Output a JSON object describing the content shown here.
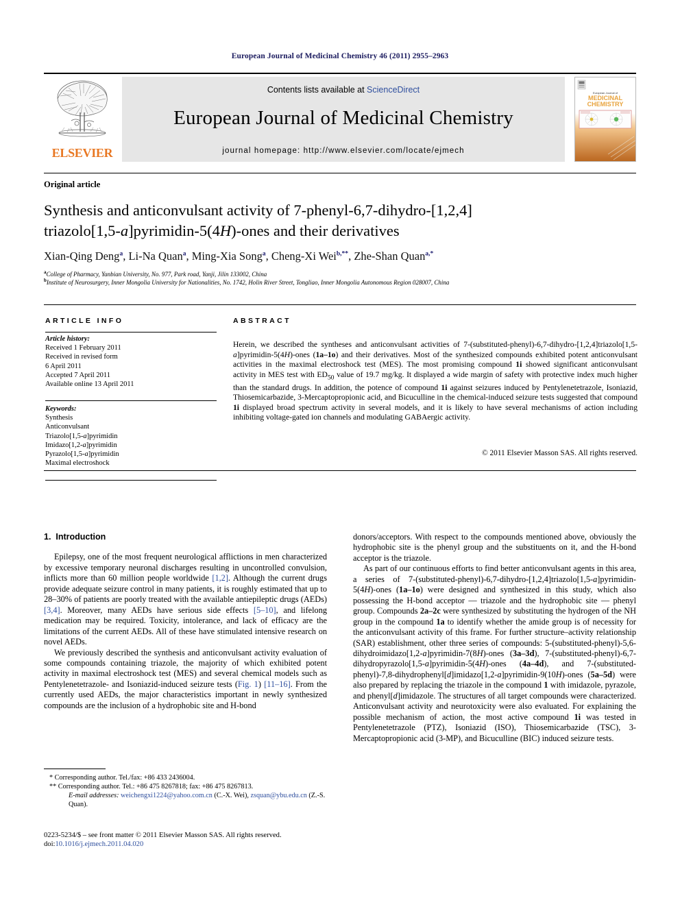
{
  "running_head": "European Journal of Medicinal Chemistry 46 (2011) 2955–2963",
  "masthead": {
    "contents_prefix": "Contents lists available at ",
    "sciencedirect": "ScienceDirect",
    "journal_title": "European Journal of Medicinal Chemistry",
    "homepage": "journal homepage: http://www.elsevier.com/locate/ejmech",
    "publisher": "ELSEVIER",
    "cover_title_small": "European Journal of",
    "cover_title_main1": "MEDICINAL",
    "cover_title_main2": "CHEMISTRY"
  },
  "article": {
    "type": "Original article",
    "title_line1": "Synthesis and anticonvulsant activity of 7-phenyl-6,7-dihydro-[1,2,4]",
    "title_line2_a": "triazolo[1,5-",
    "title_line2_b": "a",
    "title_line2_c": "]pyrimidin-5(4",
    "title_line2_d": "H",
    "title_line2_e": ")-ones and their derivatives",
    "authors": "Xian-Qing Deng a, Li-Na Quan a, Ming-Xia Song a, Cheng-Xi Wei b,**, Zhe-Shan Quan a,*",
    "affiliation_a": "College of Pharmacy, Yanbian University, No. 977, Park road, Yanji, Jilin 133002, China",
    "affiliation_b": "Institute of Neurosurgery, Inner Mongolia University for Nationalities, No. 1742, Holin River Street, Tongliao, Inner Mongolia Autonomous Region 028007, China"
  },
  "info": {
    "heading": "ARTICLE INFO",
    "history_label": "Article history:",
    "history": [
      "Received 1 February 2011",
      "Received in revised form",
      "6 April 2011",
      "Accepted 7 April 2011",
      "Available online 13 April 2011"
    ],
    "keywords_label": "Keywords:",
    "keywords": [
      "Synthesis",
      "Anticonvulsant",
      "Triazolo[1,5-a]pyrimidin",
      "Imidazo[1,2-a]pyrimidin",
      "Pyrazolo[1,5-a]pyrimidin",
      "Maximal electroshock"
    ]
  },
  "abstract": {
    "heading": "ABSTRACT",
    "text": "Herein, we described the syntheses and anticonvulsant activities of 7-(substituted-phenyl)-6,7-dihydro-[1,2,4]triazolo[1,5-a]pyrimidin-5(4H)-ones (1a–1o) and their derivatives. Most of the synthesized compounds exhibited potent anticonvulsant activities in the maximal electroshock test (MES). The most promising compound 1i showed significant anticonvulsant activity in MES test with ED50 value of 19.7 mg/kg. It displayed a wide margin of safety with protective index much higher than the standard drugs. In addition, the potence of compound 1i against seizures induced by Pentylenetetrazole, Isoniazid, Thiosemicarbazide, 3-Mercaptopropionic acid, and Bicuculline in the chemical-induced seizure tests suggested that compound 1i displayed broad spectrum activity in several models, and it is likely to have several mechanisms of action including inhibiting voltage-gated ion channels and modulating GABAergic activity.",
    "copyright": "© 2011 Elsevier Masson SAS. All rights reserved."
  },
  "body": {
    "section_number": "1.",
    "section_title": "Introduction",
    "left_paragraphs": [
      "Epilepsy, one of the most frequent neurological afflictions in men characterized by excessive temporary neuronal discharges resulting in uncontrolled convulsion, inflicts more than 60 million people worldwide [1,2]. Although the current drugs provide adequate seizure control in many patients, it is roughly estimated that up to 28–30% of patients are poorly treated with the available antiepileptic drugs (AEDs) [3,4]. Moreover, many AEDs have serious side effects [5–10], and lifelong medication may be required. Toxicity, intolerance, and lack of efficacy are the limitations of the current AEDs. All of these have stimulated intensive research on novel AEDs.",
      "We previously described the synthesis and anticonvulsant activity evaluation of some compounds containing triazole, the majority of which exhibited potent activity in maximal electroshock test (MES) and several chemical models such as Pentylenetetrazole- and Isoniazid-induced seizure tests (Fig. 1) [11–16]. From the currently used AEDs, the major characteristics important in newly synthesized compounds are the inclusion of a hydrophobic site and H-bond"
    ],
    "right_paragraphs": [
      "donors/acceptors. With respect to the compounds mentioned above, obviously the hydrophobic site is the phenyl group and the substituents on it, and the H-bond acceptor is the triazole.",
      "As part of our continuous efforts to find better anticonvulsant agents in this area, a series of 7-(substituted-phenyl)-6,7-dihydro-[1,2,4]triazolo[1,5-a]pyrimidin-5(4H)-ones (1a–1o) were designed and synthesized in this study, which also possessing the H-bond acceptor — triazole and the hydrophobic site — phenyl group. Compounds 2a–2c were synthesized by substituting the hydrogen of the NH group in the compound 1a to identify whether the amide group is of necessity for the anticonvulsant activity of this frame. For further structure–activity relationship (SAR) establishment, other three series of compounds: 5-(substituted-phenyl)-5,6-dihydroimidazo[1,2-a]pyrimidin-7(8H)-ones (3a–3d), 7-(substituted-phenyl)-6,7-dihydropyrazolo[1,5-a]pyrimidin-5(4H)-ones (4a–4d), and 7-(substituted-phenyl)-7,8-dihydrophenyl[d]imidazo[1,2-a]pyrimidin-9(10H)-ones (5a–5d) were also prepared by replacing the triazole in the compound 1 with imidazole, pyrazole, and phenyl[d]imidazole. The structures of all target compounds were characterized. Anticonvulsant activity and neurotoxicity were also evaluated. For explaining the possible mechanism of action, the most active compound 1i was tested in Pentylenetetrazole (PTZ), Isoniazid (ISO), Thiosemicarbazide (TSC), 3-Mercaptopropionic acid (3-MP), and Bicuculline (BIC) induced seizure tests."
    ]
  },
  "footnotes": {
    "corresponding_1": "* Corresponding author. Tel./fax: +86 433 2436004.",
    "corresponding_2": "** Corresponding author. Tel.: +86 475 8267818; fax: +86 475 8267813.",
    "email_label": "E-mail addresses:",
    "email_1": "weichengxi1224@yahoo.com.cn",
    "email_1_who": "(C.-X. Wei),",
    "email_2": "zsquan@ybu.edu.cn",
    "email_2_who": "(Z.-S. Quan)."
  },
  "imprint": {
    "line1": "0223-5234/$ – see front matter © 2011 Elsevier Masson SAS. All rights reserved.",
    "doi_label": "doi:",
    "doi_value": "10.1016/j.ejmech.2011.04.020"
  },
  "colors": {
    "running_head": "#1a1a5e",
    "link": "#2f4f9e",
    "elsevier_orange": "#E87722",
    "masthead_bg": "#e6e6e6"
  }
}
